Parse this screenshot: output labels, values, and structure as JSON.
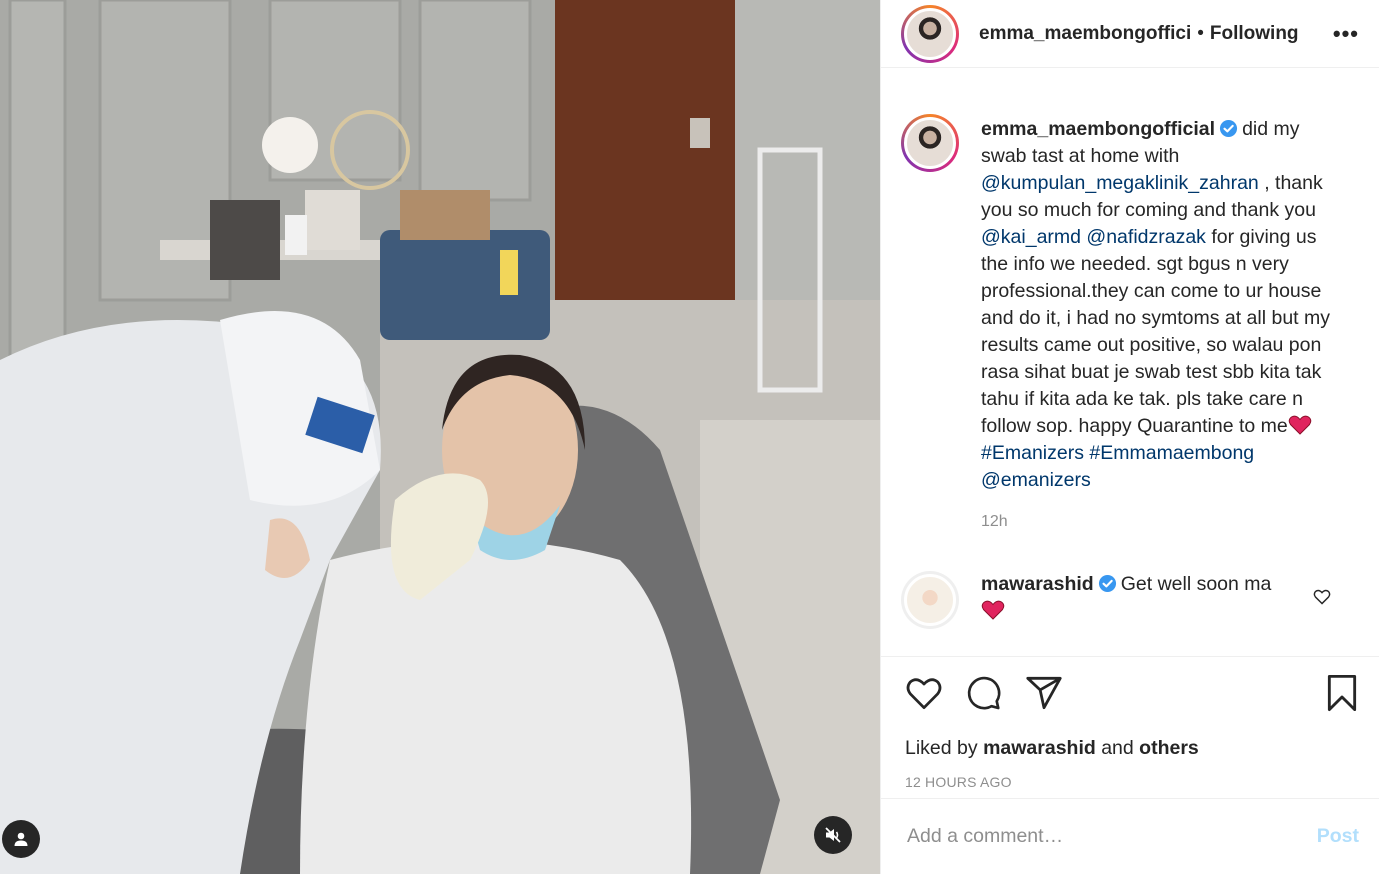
{
  "post": {
    "author": "emma_maembongofficial",
    "author_truncated": "emma_maembongoffici",
    "follow_status": "Following",
    "separator": "•",
    "more_label": "•••"
  },
  "caption": {
    "username": "emma_maembongofficial",
    "text_1": "did my swab tast at home with ",
    "mention_1": "@kumpulan_megaklinik_zahran",
    "text_2": " , thank you so much for coming and thank you ",
    "mention_2": "@kai_armd",
    "text_3": " ",
    "mention_3": "@nafidzrazak",
    "text_4": " for giving us the info we needed. sgt bgus n very professional.they can come to ur house and do it, i had no symtoms at all but my results came out positive, so walau pon rasa sihat buat je swab test sbb kita tak tahu if kita ada ke tak. pls take care n follow sop. happy Quarantine to me",
    "hashtag_1": "#Emanizers",
    "hashtag_2": "#Emmamaembong",
    "mention_4": "@emanizers",
    "time": "12h"
  },
  "comments": [
    {
      "username": "mawarashid",
      "text": "Get well soon ma"
    }
  ],
  "likes": {
    "prefix": "Liked by",
    "user": "mawarashid",
    "middle": "and",
    "others": "others"
  },
  "date_label": "12 HOURS AGO",
  "comment_box": {
    "placeholder": "Add a comment…",
    "post_label": "Post"
  },
  "colors": {
    "mention": "#00376b",
    "verified": "#3897f0",
    "post_disabled": "#b2dffc",
    "heart_emoji": "#e0245e"
  }
}
